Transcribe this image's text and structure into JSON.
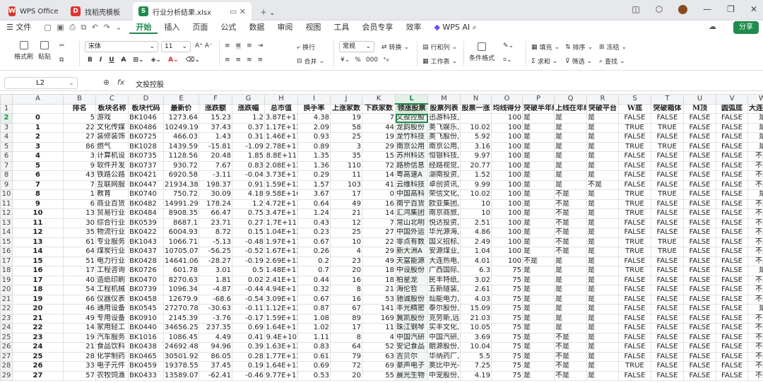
{
  "tabs": [
    {
      "label": "WPS Office",
      "icon": "wps-logo-icon",
      "color": "#d9342b"
    },
    {
      "label": "找稻壳模板",
      "icon": "docer-icon",
      "color": "#e0342f"
    },
    {
      "label": "行业分析结果.xlsx",
      "icon": "spreadsheet-icon",
      "color": "#1f8b4c"
    }
  ],
  "menu": {
    "file": "文件",
    "items": [
      "开始",
      "插入",
      "页面",
      "公式",
      "数据",
      "审阅",
      "视图",
      "工具",
      "会员专享",
      "效率"
    ],
    "active": "开始",
    "ai": "WPS AI",
    "share": "分享"
  },
  "ribbon": {
    "format_painter": "格式刷",
    "paste": "粘贴",
    "font": "宋体",
    "size": "11",
    "wrap": "换行",
    "merge": "合并",
    "numfmt": "常规",
    "convert": "转换",
    "rowcol": "行和列",
    "sheet": "工作表",
    "condfmt": "条件格式",
    "fill": "填充",
    "sort": "排序",
    "freeze": "冻结",
    "sum": "求和",
    "filter": "筛选",
    "find": "查找",
    "percent": "%",
    "comma": "000"
  },
  "formula_bar": {
    "cell_ref": "L2",
    "fx": "fx",
    "content": "文投控股"
  },
  "colors": {
    "accent": "#1f8b4c",
    "header_bg": "#f4f5f7"
  },
  "col_letters": [
    "A",
    "B",
    "C",
    "D",
    "E",
    "F",
    "G",
    "H",
    "I",
    "J",
    "K",
    "L",
    "M",
    "N",
    "O",
    "P",
    "Q",
    "R",
    "S",
    "T",
    "U",
    "V",
    "W"
  ],
  "headers": [
    "",
    "排名",
    "板块名称",
    "板块代码",
    "最新价",
    "涨跌额",
    "涨跌幅",
    "总市值",
    "换手率",
    "上涨家数",
    "下跌家数",
    "领涨股票",
    "股票列表",
    "股票一涨",
    "均线得分",
    "突破半年线",
    "上线在年线",
    "突破平台",
    "W底",
    "突破箱体",
    "M顶",
    "圆弧底",
    "大连续放"
  ],
  "rows": [
    [
      "0",
      "5",
      "游戏",
      "BK1046",
      "1273.64",
      "15.23",
      "1.2",
      "3.87E+11",
      "4.38",
      "19",
      "7",
      "文投控股",
      "迅游科技,",
      "",
      "100",
      "是",
      "是",
      "是",
      "FALSE",
      "FALSE",
      "FALSE",
      "FALSE",
      "是"
    ],
    [
      "1",
      "22",
      "文化传媒",
      "BK0486",
      "10249.19",
      "37.43",
      "0.37",
      "1.17E+12",
      "2.09",
      "58",
      "44",
      "龙韵股份",
      "奥飞娱乐,",
      "10.02",
      "100",
      "是",
      "是",
      "是",
      "TRUE",
      "TRUE",
      "FALSE",
      "FALSE",
      "是"
    ],
    [
      "2",
      "27",
      "装修装饰",
      "BK0725",
      "466.03",
      "1.43",
      "0.31",
      "1.46E+11",
      "0.93",
      "25",
      "19",
      "龙竹科技",
      "奥飞股份,",
      "5.92",
      "100",
      "是",
      "是",
      "是",
      "FALSE",
      "FALSE",
      "FALSE",
      "FALSE",
      "是"
    ],
    [
      "3",
      "86",
      "燃气",
      "BK1028",
      "1439.59",
      "-15.81",
      "-1.09",
      "2.78E+11",
      "0.89",
      "3",
      "29",
      "南京公用",
      "南京公用,",
      "3.16",
      "100",
      "是",
      "是",
      "是",
      "TRUE",
      "TRUE",
      "FALSE",
      "FALSE",
      "是"
    ],
    [
      "4",
      "3",
      "计算机设",
      "BK0735",
      "1128.56",
      "20.48",
      "1.85",
      "8.8E+11",
      "1.35",
      "35",
      "15",
      "苏州科达",
      "恒银科技,",
      "9.97",
      "100",
      "是",
      "是",
      "是",
      "FALSE",
      "FALSE",
      "FALSE",
      "FALSE",
      "不是"
    ],
    [
      "5",
      "9",
      "软件开发",
      "BK0737",
      "930.72",
      "7.67",
      "0.83",
      "2.08E+12",
      "1.36",
      "110",
      "72",
      "路桥信息",
      "经路视觉,",
      "20.77",
      "100",
      "是",
      "是",
      "是",
      "FALSE",
      "FALSE",
      "FALSE",
      "FALSE",
      "不是"
    ],
    [
      "6",
      "43",
      "铁路公路",
      "BK0421",
      "6920.58",
      "-3.11",
      "-0.04",
      "3.73E+11",
      "0.29",
      "11",
      "14",
      "粤高速A",
      "湖南投资,",
      "1.52",
      "100",
      "是",
      "是",
      "是",
      "FALSE",
      "FALSE",
      "FALSE",
      "FALSE",
      "不是"
    ],
    [
      "7",
      "7",
      "互联网服",
      "BK0447",
      "21934.38",
      "198.37",
      "0.91",
      "1.59E+12",
      "1.57",
      "103",
      "41",
      "云维科技",
      "卓创资讯,",
      "9.99",
      "100",
      "是",
      "是",
      "不是",
      "FALSE",
      "FALSE",
      "FALSE",
      "FALSE",
      "不是"
    ],
    [
      "8",
      "1",
      "教育",
      "BK0740",
      "750.72",
      "30.09",
      "4.18",
      "9.58E+10",
      "3.67",
      "17",
      "0",
      "中国高科",
      "荣信文化,",
      "10.02",
      "100",
      "是",
      "不是",
      "是",
      "TRUE",
      "TRUE",
      "FALSE",
      "FALSE",
      "是"
    ],
    [
      "9",
      "6",
      "商业百货",
      "BK0482",
      "14991.29",
      "178.24",
      "1.2",
      "4.72E+11",
      "0.64",
      "49",
      "16",
      "南宁百货",
      "欧亚集团,",
      "10",
      "100",
      "是",
      "不是",
      "是",
      "TRUE",
      "FALSE",
      "FALSE",
      "FALSE",
      "不是"
    ],
    [
      "10",
      "13",
      "贸易行业",
      "BK0484",
      "8908.35",
      "66.47",
      "0.75",
      "3.47E+11",
      "1.24",
      "21",
      "14",
      "汇鸿集团",
      "南京商旅,",
      "10",
      "100",
      "是",
      "不是",
      "是",
      "TRUE",
      "FALSE",
      "FALSE",
      "FALSE",
      "不是"
    ],
    [
      "11",
      "30",
      "综合行业",
      "BK0539",
      "8687.1",
      "23.71",
      "0.27",
      "1.7E+11",
      "0.43",
      "12",
      "7",
      "常山北明",
      "悦达投资,",
      "2.51",
      "100",
      "是",
      "不是",
      "是",
      "FALSE",
      "FALSE",
      "FALSE",
      "FALSE",
      "不是"
    ],
    [
      "12",
      "35",
      "物流行业",
      "BK0422",
      "6004.93",
      "8.72",
      "0.15",
      "1.04E+12",
      "0.23",
      "25",
      "27",
      "中国外运",
      "华光源海,",
      "4.86",
      "100",
      "是",
      "不是",
      "是",
      "FALSE",
      "FALSE",
      "FALSE",
      "FALSE",
      "不是"
    ],
    [
      "13",
      "61",
      "专业服务",
      "BK1043",
      "1066.71",
      "-5.13",
      "-0.48",
      "1.97E+11",
      "0.67",
      "10",
      "22",
      "零点有数",
      "国义招标,",
      "2.49",
      "100",
      "是",
      "不是",
      "是",
      "TRUE",
      "TRUE",
      "FALSE",
      "FALSE",
      "不是"
    ],
    [
      "14",
      "64",
      "煤炭行业",
      "BK0437",
      "10705.07",
      "-56.25",
      "-0.52",
      "1.67E+12",
      "0.26",
      "4",
      "29",
      "新大洲A",
      "安源煤业,",
      "1.04",
      "100",
      "是",
      "不是",
      "是",
      "TRUE",
      "TRUE",
      "FALSE",
      "FALSE",
      "不是"
    ],
    [
      "15",
      "51",
      "电力行业",
      "BK0428",
      "14641.06",
      "-28.27",
      "-0.19",
      "2.69E+12",
      "0.2",
      "23",
      "49",
      "天富能源",
      "大连热电,",
      "4.01",
      "100",
      "不是",
      "是",
      "是",
      "FALSE",
      "FALSE",
      "FALSE",
      "FALSE",
      "不是"
    ],
    [
      "16",
      "17",
      "工程咨询",
      "BK0726",
      "601.78",
      "3.01",
      "0.5",
      "1.48E+11",
      "0.7",
      "20",
      "18",
      "中设股份",
      "广西国际,",
      "6.3",
      "75",
      "是",
      "是",
      "是",
      "TRUE",
      "FALSE",
      "FALSE",
      "FALSE",
      "是"
    ],
    [
      "17",
      "40",
      "造纸印刷",
      "BK0470",
      "8270.63",
      "1.81",
      "0.02",
      "2.41E+11",
      "0.44",
      "16",
      "18",
      "柏星龙",
      "民丰特纸,",
      "3.02",
      "75",
      "是",
      "是",
      "是",
      "FALSE",
      "FALSE",
      "FALSE",
      "FALSE",
      "不是"
    ],
    [
      "18",
      "54",
      "工程机械",
      "BK0739",
      "1096.34",
      "-4.87",
      "-0.44",
      "4.94E+11",
      "0.32",
      "8",
      "21",
      "海伦哲",
      "五新隧装,",
      "2.61",
      "75",
      "是",
      "是",
      "是",
      "FALSE",
      "FALSE",
      "FALSE",
      "FALSE",
      "不是"
    ],
    [
      "19",
      "66",
      "仪器仪表",
      "BK0458",
      "12679.9",
      "-68.6",
      "-0.54",
      "3.09E+11",
      "0.67",
      "16",
      "53",
      "驰诚股份",
      "灿能电力,",
      "4.03",
      "75",
      "是",
      "是",
      "是",
      "FALSE",
      "FALSE",
      "FALSE",
      "FALSE",
      "不是"
    ],
    [
      "20",
      "46",
      "通用设备",
      "BK0545",
      "27270.78",
      "-30.63",
      "-0.11",
      "1.12E+12",
      "0.87",
      "67",
      "141",
      "丰光精密",
      "泰尔股份,",
      "15.09",
      "75",
      "是",
      "是",
      "是",
      "FALSE",
      "FALSE",
      "FALSE",
      "FALSE",
      "是"
    ],
    [
      "21",
      "49",
      "专用设备",
      "BK0910",
      "2145.39",
      "-3.76",
      "-0.17",
      "1.59E+12",
      "1.08",
      "89",
      "169",
      "冀凯股份",
      "克劳斯,远",
      "21.03",
      "75",
      "是",
      "是",
      "是",
      "FALSE",
      "FALSE",
      "FALSE",
      "FALSE",
      "不是"
    ],
    [
      "22",
      "14",
      "家用轻工",
      "BK0440",
      "34656.25",
      "237.35",
      "0.69",
      "1.64E+11",
      "1.02",
      "17",
      "11",
      "珠江钢琴",
      "实丰文化,",
      "10.05",
      "75",
      "是",
      "是",
      "是",
      "FALSE",
      "FALSE",
      "FALSE",
      "FALSE",
      "不是"
    ],
    [
      "23",
      "19",
      "汽车服务",
      "BK1016",
      "1086.45",
      "4.49",
      "0.41",
      "9.4E+10",
      "1.11",
      "8",
      "4",
      "中国汽研",
      "中国汽研,",
      "3.69",
      "75",
      "是",
      "不是",
      "是",
      "FALSE",
      "FALSE",
      "FALSE",
      "FALSE",
      "不是"
    ],
    [
      "24",
      "21",
      "食品饮料",
      "BK0438",
      "24692.48",
      "94.96",
      "0.39",
      "1.63E+12",
      "0.83",
      "64",
      "52",
      "安记食品",
      "朗源股份,",
      "10.04",
      "75",
      "是",
      "不是",
      "是",
      "FALSE",
      "FALSE",
      "FALSE",
      "FALSE",
      "不是"
    ],
    [
      "25",
      "28",
      "化学制药",
      "BK0465",
      "30501.92",
      "86.05",
      "0.28",
      "1.77E+12",
      "0.61",
      "79",
      "63",
      "吉贝尔",
      "华纳药厂,",
      "5.5",
      "75",
      "是",
      "不是",
      "是",
      "FALSE",
      "FALSE",
      "FALSE",
      "FALSE",
      "不是"
    ],
    [
      "26",
      "33",
      "电子元件",
      "BK0459",
      "19378.55",
      "37.45",
      "0.19",
      "1.64E+12",
      "0.69",
      "72",
      "69",
      "豪声电子",
      "奥比中光-",
      "7.25",
      "75",
      "是",
      "不是",
      "是",
      "TRUE",
      "FALSE",
      "FALSE",
      "FALSE",
      "不是"
    ],
    [
      "27",
      "57",
      "农牧饲渔",
      "BK0433",
      "13589.07",
      "-62.41",
      "-0.46",
      "9.77E+11",
      "0.53",
      "20",
      "55",
      "晨光生物",
      "中宠股份,",
      "4.19",
      "75",
      "是",
      "不是",
      "是",
      "FALSE",
      "FALSE",
      "FALSE",
      "FALSE",
      "不是"
    ]
  ]
}
